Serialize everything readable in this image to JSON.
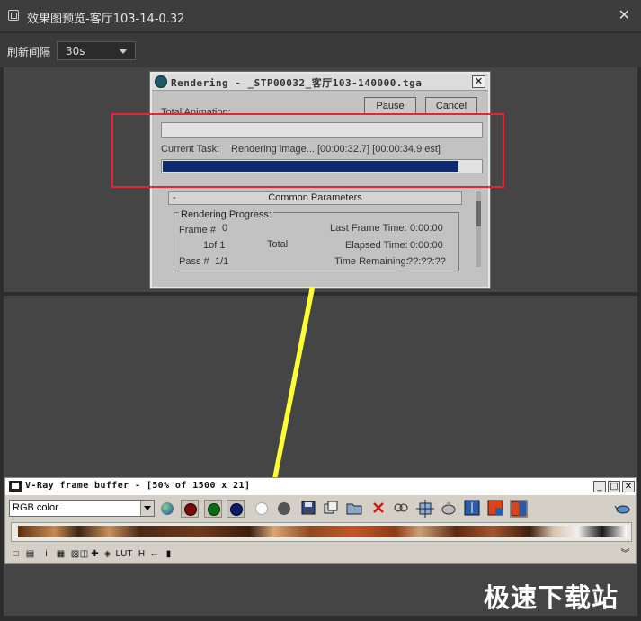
{
  "window": {
    "title": "效果图预览-客厅103-14-0.32",
    "close_glyph": "✕",
    "icon": "window-icon"
  },
  "toolbar": {
    "refresh_label": "刷新间隔",
    "refresh_value": "30s"
  },
  "render_dialog": {
    "title": "Rendering - _STP00032_客厅103-140000.tga",
    "close_glyph": "✕",
    "pause_label": "Pause",
    "cancel_label": "Cancel",
    "total_label": "Total Animation:",
    "current_label": "Current Task:",
    "current_text": "Rendering image... [00:00:32.7] [00:00:34.9 est]",
    "current_progress": 0.93,
    "total_progress": 0,
    "rollout_title": "Common Parameters",
    "rollout_toggle": "-",
    "group_title": "Rendering Progress:",
    "frame_label": "Frame #",
    "frame_value": "0",
    "of_text": "1of 1",
    "total_text": "Total",
    "pass_label": "Pass #",
    "pass_value": "1/1",
    "last_frame_label": "Last Frame Time:",
    "last_frame_value": "0:00:00",
    "elapsed_label": "Elapsed Time:",
    "elapsed_value": "0:00:00",
    "remaining_label": "Time Remaining:",
    "remaining_value": "??:??:??"
  },
  "vray": {
    "title": "V-Ray frame buffer - [50% of 1500 x 21]",
    "min_glyph": "_",
    "max_glyph": "□",
    "close_glyph": "✕",
    "channel": "RGB color",
    "bottom_glyphs": [
      "□",
      "▤",
      "i",
      "▦",
      "▨",
      "◫",
      "✚",
      "◈",
      "LUT",
      "H",
      "↔",
      "▮"
    ]
  },
  "watermark": "极速下载站",
  "colors": {
    "accent_red": "#e8262a",
    "arrow_yellow": "#ffff33",
    "progress_blue": "#0f2a74"
  }
}
